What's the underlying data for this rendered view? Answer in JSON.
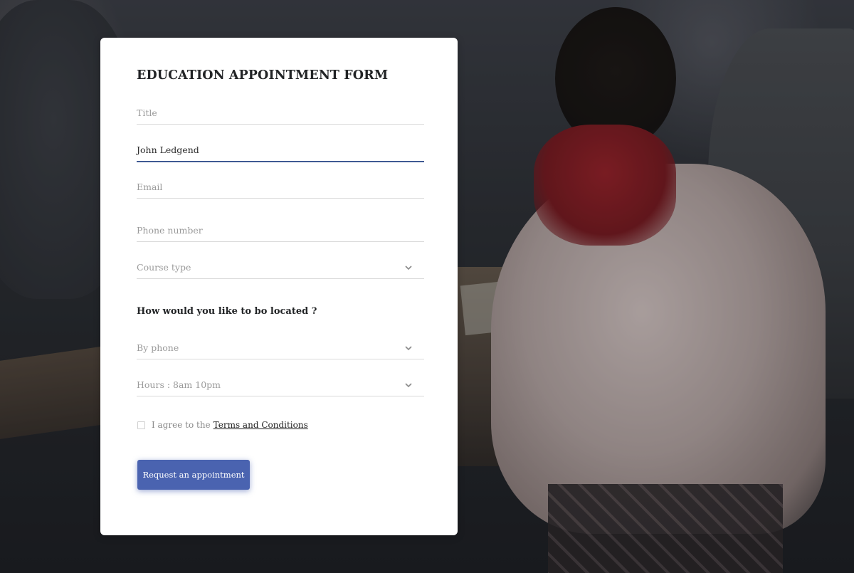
{
  "form": {
    "title": "EDUCATION APPOINTMENT FORM",
    "fields": {
      "title": {
        "placeholder": "Title",
        "value": ""
      },
      "name": {
        "placeholder": "",
        "value": "John Ledgend"
      },
      "email": {
        "placeholder": "Email",
        "value": ""
      },
      "phone": {
        "placeholder": "Phone number",
        "value": ""
      },
      "course_type": {
        "selected": "Course type",
        "icon": "chevron-down-icon"
      }
    },
    "location_question": "How would you like to bo located ?",
    "location_fields": {
      "method": {
        "selected": "By phone",
        "icon": "chevron-down-icon"
      },
      "hours": {
        "selected": "Hours : 8am 10pm",
        "icon": "chevron-down-icon"
      }
    },
    "agreement": {
      "checked": false,
      "prefix": "I agree to the",
      "link_text": "Terms and Conditions"
    },
    "submit_label": "Request an appointment"
  },
  "colors": {
    "accent": "#4a63b0",
    "active_underline": "#3f5a93",
    "card_background": "#ffffff",
    "heading_text": "#222426",
    "placeholder_text": "#9a9a9a"
  }
}
